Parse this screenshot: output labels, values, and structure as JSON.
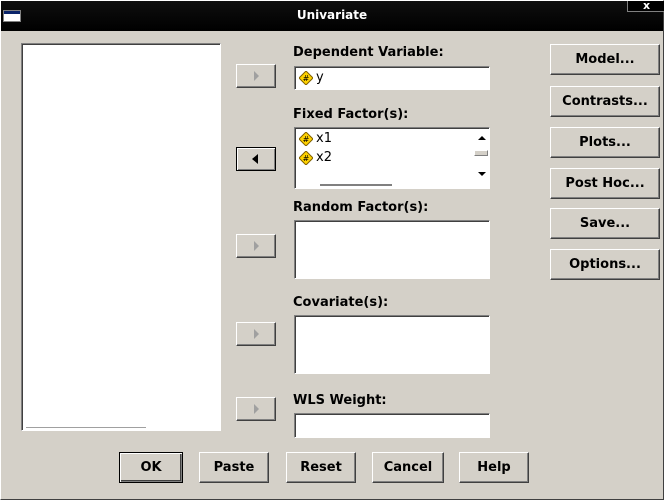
{
  "window": {
    "title": "Univariate",
    "close_label": "x"
  },
  "fields": {
    "dependent": {
      "label": "Dependent Variable:",
      "items": [
        {
          "name": "y",
          "icon": "scale-variable-icon"
        }
      ]
    },
    "fixed": {
      "label": "Fixed Factor(s):",
      "items": [
        {
          "name": "x1",
          "icon": "scale-variable-icon"
        },
        {
          "name": "x2",
          "icon": "scale-variable-icon"
        }
      ]
    },
    "random": {
      "label": "Random Factor(s):",
      "items": []
    },
    "covariates": {
      "label": "Covariate(s):",
      "items": []
    },
    "wls": {
      "label": "WLS Weight:",
      "items": []
    }
  },
  "side_buttons": {
    "model": "Model...",
    "contrasts": "Contrasts...",
    "plots": "Plots...",
    "post_hoc": "Post Hoc...",
    "save": "Save...",
    "options": "Options..."
  },
  "bottom_buttons": {
    "ok": "OK",
    "paste": "Paste",
    "reset": "Reset",
    "cancel": "Cancel",
    "help": "Help"
  },
  "colors": {
    "dialog_face": "#d4d0c8",
    "titlebar": "#000000",
    "variable_icon": "#ffd200"
  }
}
